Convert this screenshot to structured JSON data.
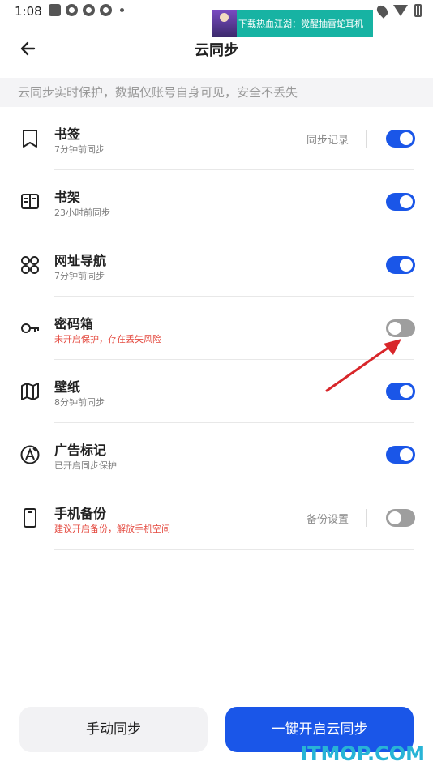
{
  "status_bar": {
    "time": "1:08"
  },
  "ad": {
    "text": "下载热血江湖：觉醒抽雷蛇耳机"
  },
  "header": {
    "title": "云同步"
  },
  "info": {
    "text": "云同步实时保护，数据仅账号自身可见，安全不丢失"
  },
  "items": [
    {
      "title": "书签",
      "subtitle": "7分钟前同步",
      "warning": false,
      "link": "同步记录",
      "enabled": true,
      "icon": "bookmark-icon"
    },
    {
      "title": "书架",
      "subtitle": "23小时前同步",
      "warning": false,
      "link": "",
      "enabled": true,
      "icon": "bookshelf-icon"
    },
    {
      "title": "网址导航",
      "subtitle": "7分钟前同步",
      "warning": false,
      "link": "",
      "enabled": true,
      "icon": "grid-icon"
    },
    {
      "title": "密码箱",
      "subtitle": "未开启保护，存在丢失风险",
      "warning": true,
      "link": "",
      "enabled": false,
      "icon": "key-icon"
    },
    {
      "title": "壁纸",
      "subtitle": "8分钟前同步",
      "warning": false,
      "link": "",
      "enabled": true,
      "icon": "map-icon"
    },
    {
      "title": "广告标记",
      "subtitle": "已开启同步保护",
      "warning": false,
      "link": "",
      "enabled": true,
      "icon": "ad-mark-icon"
    },
    {
      "title": "手机备份",
      "subtitle": "建议开启备份，解放手机空间",
      "warning": true,
      "link": "备份设置",
      "enabled": false,
      "icon": "phone-icon"
    }
  ],
  "buttons": {
    "manual": "手动同步",
    "enable": "一键开启云同步"
  },
  "watermark": "ITMOP.COM",
  "colors": {
    "accent": "#1a56e8",
    "warning": "#e4493f",
    "toggle_off": "#9e9e9e",
    "annotation": "#d8262a"
  }
}
